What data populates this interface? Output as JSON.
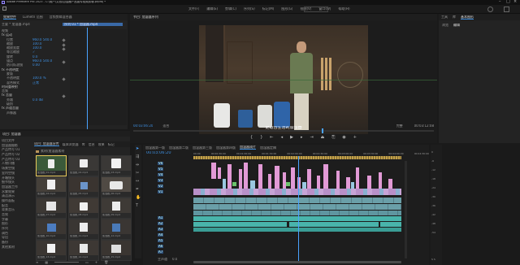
{
  "titlebar": {
    "title": "Adobe Premiere Pro 2023 - C:\\用户\\文档\\加湿器产品宣传视频剪辑.prproj *"
  },
  "menu": [
    "文件(F)",
    "编辑(E)",
    "剪辑(C)",
    "序列(S)",
    "标记(M)",
    "图形(G)",
    "视图(V)",
    "窗口(W)",
    "帮助(H)"
  ],
  "source_tabs": [
    "效果控件",
    "Lumetri 范围",
    "音频剪辑混合器"
  ],
  "effect_controls": {
    "clip_label": "主要 * 加湿器.mp4",
    "seq_label": "序列 01 * 加湿器.mp4",
    "rows": [
      "视频",
      "fx 运动",
      "位置",
      "缩放",
      "缩放宽度",
      "等比缩放",
      "旋转",
      "锚点",
      "防闪烁滤镜",
      "fx 不透明度",
      "蒙版",
      "不透明度",
      "混合模式",
      "时间重映射",
      "音频",
      "fx 音量",
      "旁路",
      "级别",
      "fx 声道音量",
      "声像器"
    ],
    "values": [
      "960.0  540.0",
      "100.0",
      "100.0",
      "✓",
      "0.0",
      "960.0  540.0",
      "0.00",
      "",
      "",
      "100.0 %",
      "正常",
      "",
      "",
      "",
      "0.0 dB",
      "",
      "",
      ""
    ]
  },
  "program_monitor": {
    "tab": "节目: 加湿器序列",
    "subtitle": "更适合生活的加湿器",
    "timecode_in": "00:03:06:20",
    "fit": "适合",
    "quality": "完整",
    "timecode_out": "00:03:12:08"
  },
  "right_panel": {
    "tabs": [
      "工具",
      "库",
      "基本图形"
    ],
    "buttons": [
      "浏览",
      "编辑"
    ]
  },
  "project": {
    "tab": "项目: 加湿器",
    "tabs2": [
      "项目: 加湿器宣传",
      "媒体浏览器",
      "库",
      "信息",
      "效果",
      "标记",
      "历史记录"
    ],
    "folder": "素材/加湿器素材",
    "tree": [
      "项目文件",
      "加湿器摄影",
      "产品特写 01",
      "产品特写 02",
      "产品特写 03",
      "人物口播",
      "场景空镜",
      "室内空镜",
      "开箱镜头",
      "细节镜头",
      "加湿器工作",
      "水雾效果",
      "清洁演示",
      "操作面板",
      "配音",
      "背景音乐",
      "音效",
      "字幕",
      "图形",
      "序列",
      "调色",
      "导出",
      "备份",
      "其他素材"
    ],
    "thumbs": [
      "加湿器_01.mp4",
      "加湿器_02.mp4",
      "加湿器_03.mp4",
      "加湿器_04.mp4",
      "加湿器_05.mp4",
      "加湿器_06.mp4",
      "加湿器_07.mp4",
      "加湿器_08.mp4",
      "加湿器_09.mp4",
      "加湿器_10.mp4",
      "加湿器_11.mp4",
      "加湿器_12.mp4",
      "加湿器_13.mp4",
      "加湿器_14.mp4",
      "加湿器_15.mp4"
    ]
  },
  "timeline": {
    "tabs": [
      "加湿器第一版",
      "加湿器第二版",
      "加湿器第三版",
      "加湿器第四版",
      "加湿器成片",
      "加湿器定稿"
    ],
    "timecode": "00:03:06:20",
    "ruler": [
      "00:00",
      "00:00:30:00",
      "00:01:00:00",
      "00:01:30:00",
      "00:02:00:00",
      "00:02:30:00",
      "00:03:00:00",
      "00:03:30:00",
      "00:04:00:00",
      "00:04:30:00"
    ],
    "tracks": [
      "V6",
      "V5",
      "V4",
      "V3",
      "V2",
      "V1",
      "A1",
      "A2",
      "A3",
      "A4",
      "A5",
      "A6",
      "A7",
      "主声道"
    ],
    "master_value": "0.0"
  },
  "audio_meter": {
    "labels": [
      "0",
      "-6",
      "-12",
      "-18",
      "-24",
      "-30",
      "-36",
      "-42",
      "-48",
      "-54"
    ],
    "footer": "S S"
  },
  "colors": {
    "accent": "#3e8fe0",
    "video_clip": "#e29ad6",
    "video_clip_alt": "#9ac8e0",
    "audio_clip": "#49b4ab",
    "audio_clip2": "#6a9fa8",
    "yellow": "#c2a14a",
    "playhead": "#4aa3ff"
  }
}
